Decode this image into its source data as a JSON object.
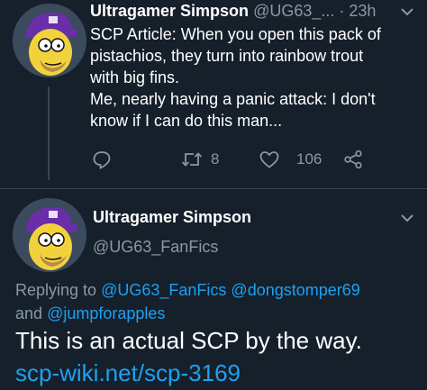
{
  "tweet1": {
    "author_name": "Ultragamer Simpson",
    "handle": "@UG63_...",
    "separator": "·",
    "time": "23h",
    "lines": [
      "SCP Article: When you open this pack of",
      "pistachios, they turn into rainbow trout",
      "with big fins.",
      "Me, nearly having a panic attack: I don't",
      "know if I can do this man..."
    ],
    "actions": {
      "reply_icon": "comment-icon",
      "retweet_icon": "retweet-icon",
      "retweet_count": "8",
      "like_icon": "heart-icon",
      "like_count": "106",
      "share_icon": "share-icon"
    }
  },
  "tweet2": {
    "author_name": "Ultragamer Simpson",
    "handle": "@UG63_FanFics",
    "replying_prefix": "Replying to",
    "mention1": "@UG63_FanFics",
    "mention2": "@dongstomper69",
    "and_text": "and",
    "mention3": "@jumpforapples",
    "text": "This is an actual SCP by the way.",
    "link": "scp-wiki.net/scp-3169"
  },
  "colors": {
    "background": "#15202b",
    "muted": "#8899a6",
    "link": "#1da1f2"
  }
}
